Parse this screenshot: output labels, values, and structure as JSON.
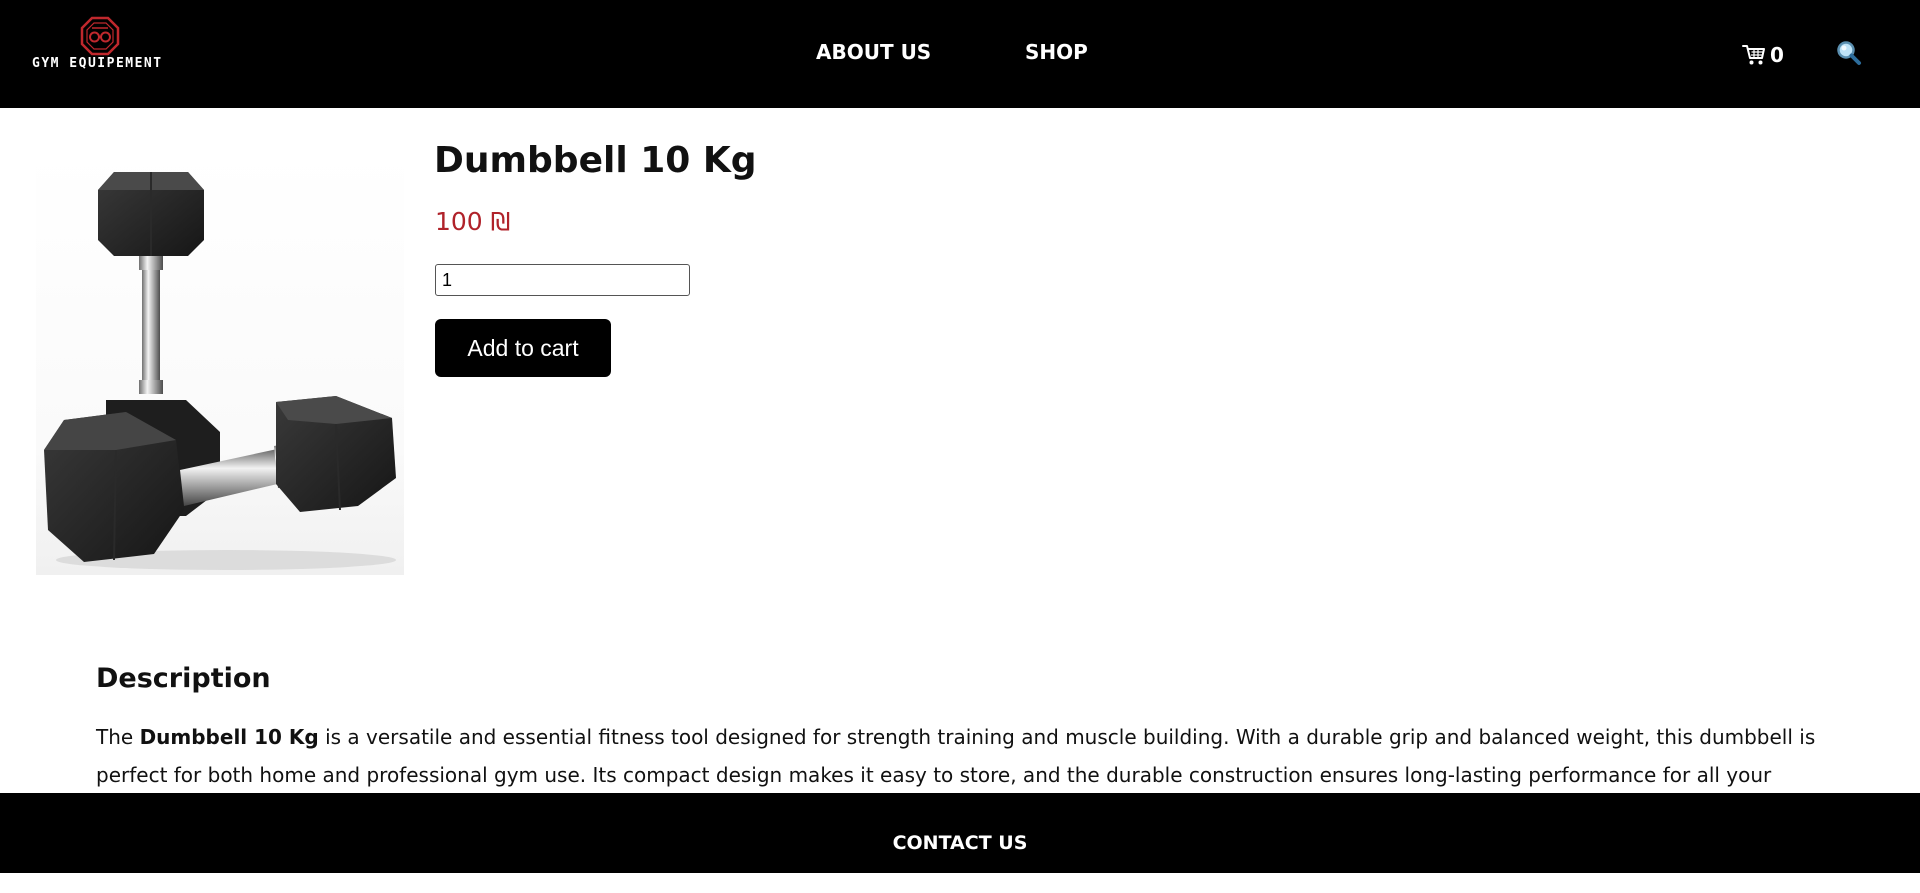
{
  "header": {
    "logo_text": "GYM EQUIPEMENT",
    "nav": [
      {
        "label": "ABOUT US"
      },
      {
        "label": "SHOP"
      }
    ],
    "cart": {
      "count": "0",
      "icon": "cart-icon"
    },
    "search": {
      "icon": "search-icon"
    }
  },
  "product": {
    "title": "Dumbbell 10 Kg",
    "price": "100 ₪",
    "quantity": "1",
    "add_to_cart_label": "Add to cart"
  },
  "description": {
    "heading": "Description",
    "intro": "The ",
    "product_name": "Dumbbell 10 Kg",
    "body": " is a versatile and essential fitness tool designed for strength training and muscle building. With a durable grip and balanced weight, this dumbbell is perfect for both home and professional gym use. Its compact design makes it easy to store, and the durable construction ensures long-lasting performance for all your workout needs."
  },
  "footer": {
    "contact_label": "CONTACT US"
  },
  "colors": {
    "header_bg": "#000000",
    "price": "#b0222a",
    "logo_accent": "#c0282d"
  }
}
